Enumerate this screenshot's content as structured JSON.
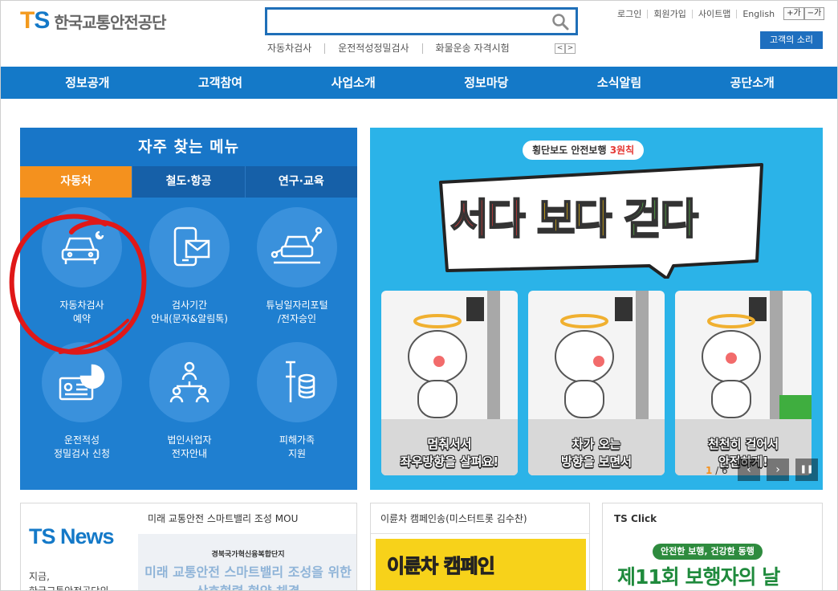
{
  "logo": {
    "mark_t": "T",
    "mark_s": "S",
    "text": "한국교통안전공단"
  },
  "search": {
    "placeholder": ""
  },
  "keywords": [
    "자동차검사",
    "운전적성정밀검사",
    "화물운송 자격시험"
  ],
  "keyword_arrows": {
    "prev": "<",
    "next": ">"
  },
  "util": {
    "login": "로그인",
    "join": "회원가입",
    "sitemap": "사이트맵",
    "english": "English",
    "zoom_in": "+가",
    "zoom_out": "−가"
  },
  "voice_button": "고객의 소리",
  "gnb": [
    "정보공개",
    "고객참여",
    "사업소개",
    "정보마당",
    "소식알림",
    "공단소개"
  ],
  "quick": {
    "title": "자주 찾는 메뉴",
    "tabs": [
      "자동차",
      "철도·항공",
      "연구·교육"
    ],
    "items": [
      {
        "label": "자동차검사\n예약",
        "icon": "car-inspection-icon"
      },
      {
        "label": "검사기간\n안내(문자&알림톡)",
        "icon": "mobile-mail-icon"
      },
      {
        "label": "튜닝일자리포털\n/전자승인",
        "icon": "car-tuning-icon"
      },
      {
        "label": "운전적성\n정밀검사 신청",
        "icon": "aptitude-chart-icon"
      },
      {
        "label": "법인사업자\n전자안내",
        "icon": "corporate-people-icon"
      },
      {
        "label": "피해가족\n지원",
        "icon": "crutch-coins-icon"
      }
    ]
  },
  "banner": {
    "tag_prefix": "횡단보도 안전보행 ",
    "tag_highlight": "3원칙",
    "slogan": [
      "서다",
      "보다",
      "걷다"
    ],
    "captions": [
      "멈춰서서\n좌우방향을 살펴요!",
      "차가 오는\n방향을 보면서",
      "천천히 걸어서\n안전하게!"
    ],
    "pager_current": "1",
    "pager_total": "/ 6",
    "prev": "‹",
    "next": "›",
    "pause": "❚❚"
  },
  "news": {
    "title": "TS News",
    "desc": "지금,\n한국교통안전공단의",
    "headline": "미래 교통안전 스마트밸리 조성 MOU",
    "img_line1": "경북국가혁신융복합단지",
    "img_line2": "미래 교통안전 스마트밸리 조성을 위한",
    "img_line3": "상호협력 협약 체결"
  },
  "campaign": {
    "headline": "이륜차 캠페인송(미스터트롯 김수찬)",
    "img_text": "이륜차 캠페인"
  },
  "ts_click": {
    "headline": "TS Click",
    "badge": "안전한 보행, 건강한 동행",
    "big": "제11회 보행자의 날"
  },
  "colors": {
    "brand_blue": "#1479c8",
    "brand_orange": "#f39a1e",
    "banner_bg": "#2bb3e8"
  }
}
